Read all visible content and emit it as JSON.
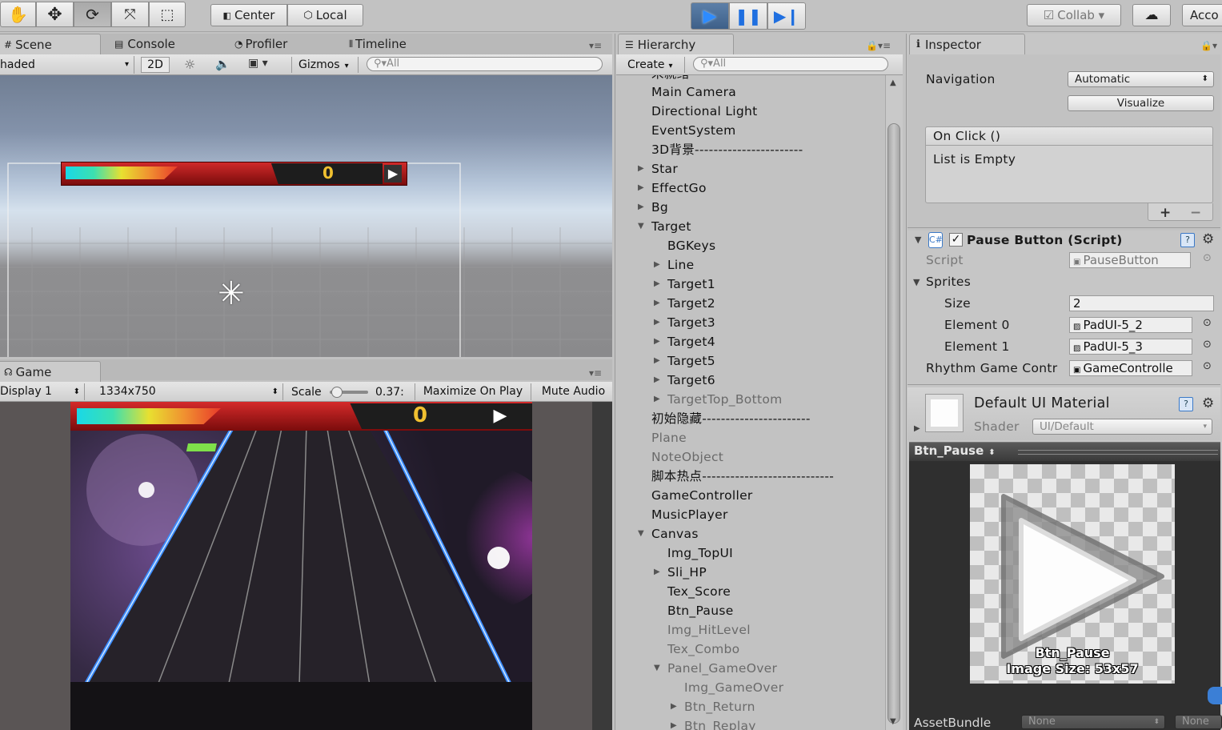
{
  "toolbar": {
    "pivot_label": "Center",
    "space_label": "Local",
    "collab_label": "Collab ▾",
    "account_label": "Acco"
  },
  "scene": {
    "tab_scene": "Scene",
    "tab_console": "Console",
    "tab_profiler": "Profiler",
    "tab_timeline": "Timeline",
    "shading": "haded",
    "mode_2d": "2D",
    "gizmos": "Gizmos",
    "search_placeholder": "All",
    "score": "0"
  },
  "game": {
    "tab_game": "Game",
    "display": "Display 1",
    "resolution": "1334x750",
    "scale_label": "Scale",
    "scale_value": "0.37:",
    "maximize": "Maximize On Play",
    "mute": "Mute Audio",
    "score": "0"
  },
  "hierarchy": {
    "title": "Hierarchy",
    "create": "Create",
    "search_placeholder": "All",
    "cutoff_top": "未就绪",
    "items": [
      {
        "label": "Main Camera",
        "level": 0,
        "arrow": "",
        "dim": false
      },
      {
        "label": "Directional Light",
        "level": 0,
        "arrow": "",
        "dim": false
      },
      {
        "label": "EventSystem",
        "level": 0,
        "arrow": "",
        "dim": false
      },
      {
        "label": "3D背景-----------------------",
        "level": 0,
        "arrow": "",
        "dim": false
      },
      {
        "label": "Star",
        "level": 0,
        "arrow": "right",
        "dim": false
      },
      {
        "label": "EffectGo",
        "level": 0,
        "arrow": "right",
        "dim": false
      },
      {
        "label": "Bg",
        "level": 0,
        "arrow": "right",
        "dim": false
      },
      {
        "label": "Target",
        "level": 0,
        "arrow": "down",
        "dim": false
      },
      {
        "label": "BGKeys",
        "level": 1,
        "arrow": "",
        "dim": false
      },
      {
        "label": "Line",
        "level": 1,
        "arrow": "right",
        "dim": false
      },
      {
        "label": "Target1",
        "level": 1,
        "arrow": "right",
        "dim": false
      },
      {
        "label": "Target2",
        "level": 1,
        "arrow": "right",
        "dim": false
      },
      {
        "label": "Target3",
        "level": 1,
        "arrow": "right",
        "dim": false
      },
      {
        "label": "Target4",
        "level": 1,
        "arrow": "right",
        "dim": false
      },
      {
        "label": "Target5",
        "level": 1,
        "arrow": "right",
        "dim": false
      },
      {
        "label": "Target6",
        "level": 1,
        "arrow": "right",
        "dim": false
      },
      {
        "label": "TargetTop_Bottom",
        "level": 1,
        "arrow": "right",
        "dim": true
      },
      {
        "label": "初始隐藏-----------------------",
        "level": 0,
        "arrow": "",
        "dim": false
      },
      {
        "label": "Plane",
        "level": 0,
        "arrow": "",
        "dim": true
      },
      {
        "label": "NoteObject",
        "level": 0,
        "arrow": "",
        "dim": true
      },
      {
        "label": "脚本热点----------------------------",
        "level": 0,
        "arrow": "",
        "dim": false
      },
      {
        "label": "GameController",
        "level": 0,
        "arrow": "",
        "dim": false
      },
      {
        "label": "MusicPlayer",
        "level": 0,
        "arrow": "",
        "dim": false
      },
      {
        "label": "Canvas",
        "level": 0,
        "arrow": "down",
        "dim": false
      },
      {
        "label": "Img_TopUI",
        "level": 1,
        "arrow": "",
        "dim": false
      },
      {
        "label": "Sli_HP",
        "level": 1,
        "arrow": "right",
        "dim": false
      },
      {
        "label": "Tex_Score",
        "level": 1,
        "arrow": "",
        "dim": false
      },
      {
        "label": "Btn_Pause",
        "level": 1,
        "arrow": "",
        "dim": false
      },
      {
        "label": "Img_HitLevel",
        "level": 1,
        "arrow": "",
        "dim": true
      },
      {
        "label": "Tex_Combo",
        "level": 1,
        "arrow": "",
        "dim": true
      },
      {
        "label": "Panel_GameOver",
        "level": 1,
        "arrow": "down",
        "dim": true
      },
      {
        "label": "Img_GameOver",
        "level": 2,
        "arrow": "",
        "dim": true
      },
      {
        "label": "Btn_Return",
        "level": 2,
        "arrow": "right",
        "dim": true
      },
      {
        "label": "Btn_Replay",
        "level": 2,
        "arrow": "right",
        "dim": true
      }
    ]
  },
  "inspector": {
    "title": "Inspector",
    "navigation_label": "Navigation",
    "navigation_value": "Automatic",
    "visualize": "Visualize",
    "onclick_header": "On Click ()",
    "onclick_empty": "List is Empty",
    "component_title": "Pause Button (Script)",
    "script_label": "Script",
    "script_value": "PauseButton",
    "sprites_label": "Sprites",
    "size_label": "Size",
    "size_value": "2",
    "element0_label": "Element 0",
    "element0_value": "PadUI-5_2",
    "element1_label": "Element 1",
    "element1_value": "PadUI-5_3",
    "rhythm_label": "Rhythm Game Contr",
    "rhythm_value": "GameControlle",
    "material_name": "Default UI Material",
    "shader_label": "Shader",
    "shader_value": "UI/Default",
    "preview_title": "Btn_Pause",
    "preview_name": "Btn_Pause",
    "preview_size": "Image Size: 53x57",
    "assetbundle_label": "AssetBundle",
    "assetbundle_value": "None",
    "assetbundle_variant": "None"
  }
}
